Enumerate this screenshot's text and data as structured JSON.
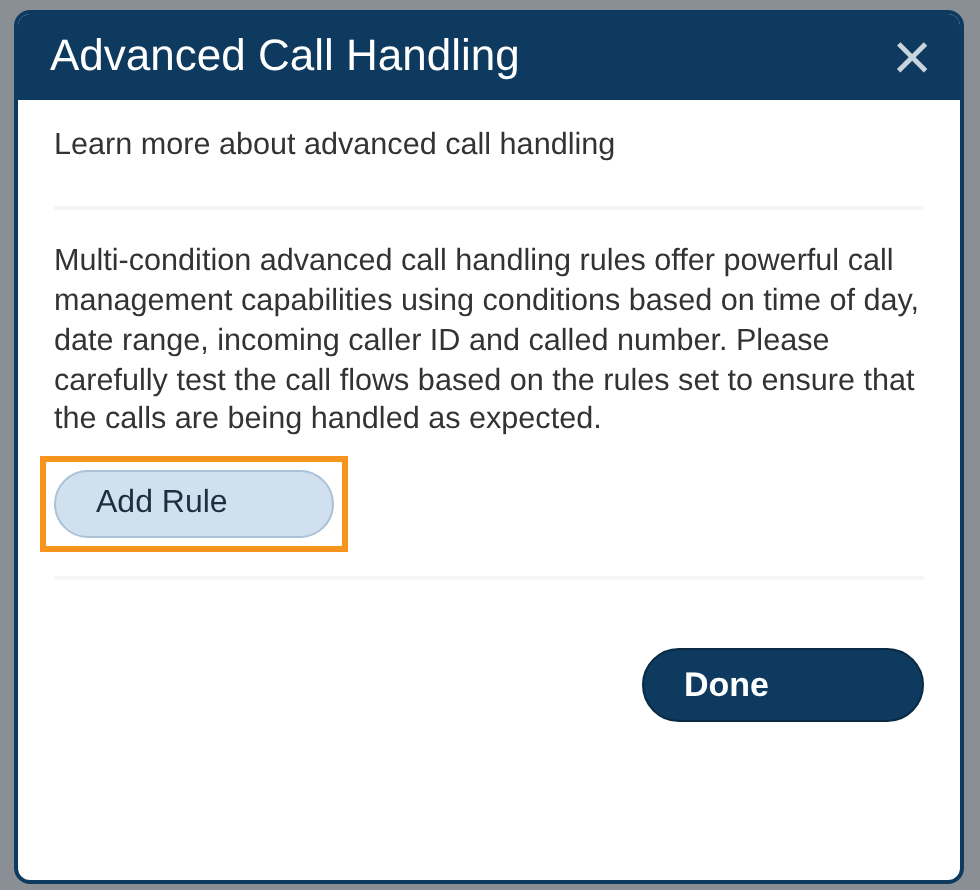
{
  "dialog": {
    "title": "Advanced Call Handling",
    "close": "×",
    "link": "Learn more about advanced call handling",
    "description": "Multi-condition advanced call handling rules offer powerful call management capabilities using conditions based on time of day, date range, incoming caller ID and called number. Please carefully test the call flows based on the rules set to ensure that the calls are being handled as expected.",
    "add_button": {
      "label": "Add Rule",
      "highlighted": true
    },
    "done_button": {
      "label": "Done"
    }
  }
}
